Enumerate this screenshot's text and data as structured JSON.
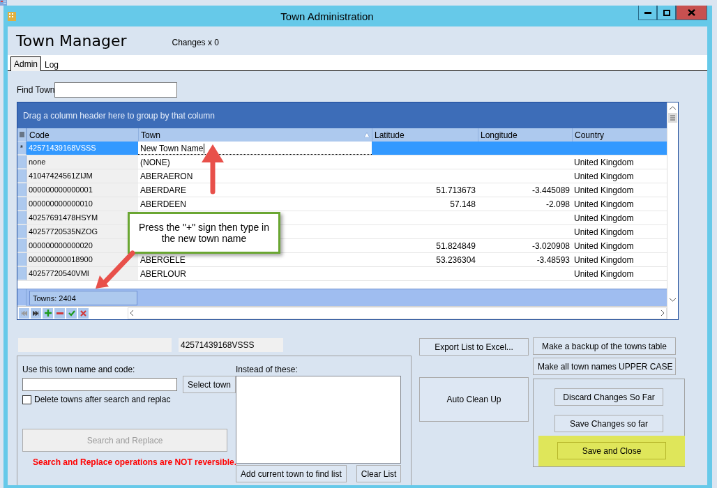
{
  "window": {
    "title": "Town Administration"
  },
  "header": {
    "title": "Town Manager",
    "changes": "Changes x 0"
  },
  "tabs": [
    {
      "label": "Admin",
      "selected": true
    },
    {
      "label": "Log",
      "selected": false
    }
  ],
  "find": {
    "label": "Find Town"
  },
  "grid": {
    "group_hint": "Drag a column header here to group by that column",
    "columns": [
      {
        "label": "Code",
        "sorted": false
      },
      {
        "label": "Town",
        "sorted": true
      },
      {
        "label": "Latitude",
        "sorted": false
      },
      {
        "label": "Longitude",
        "sorted": false
      },
      {
        "label": "Country",
        "sorted": false
      }
    ],
    "rows": [
      {
        "indicator": "*",
        "selected": true,
        "editing": true,
        "code": "42571439168VSSS",
        "town": "New Town Name"
      },
      {
        "selected": false,
        "editing": false,
        "code": "none",
        "town": "(NONE)",
        "country": "United Kingdom"
      },
      {
        "selected": false,
        "editing": false,
        "code": "41047424561ZIJM",
        "town": "ABERAERON",
        "country": "United Kingdom"
      },
      {
        "selected": false,
        "editing": false,
        "code": "000000000000001",
        "town": "ABERDARE",
        "latitude": "51.713673",
        "longitude": "-3.445089",
        "country": "United Kingdom"
      },
      {
        "selected": false,
        "editing": false,
        "code": "000000000000010",
        "town": "ABERDEEN",
        "latitude": "57.148",
        "longitude": "-2.098",
        "country": "United Kingdom"
      },
      {
        "selected": false,
        "editing": false,
        "code": "40257691478HSYM",
        "country": "United Kingdom"
      },
      {
        "selected": false,
        "editing": false,
        "code": "40257720535NZOG",
        "country": "United Kingdom"
      },
      {
        "selected": false,
        "editing": false,
        "code": "000000000000020",
        "latitude": "51.824849",
        "longitude": "-3.020908",
        "country": "United Kingdom"
      },
      {
        "selected": false,
        "editing": false,
        "code": "000000000018900",
        "town": "ABERGELE",
        "latitude": "53.236304",
        "longitude": "-3.48593",
        "country": "United Kingdom"
      },
      {
        "selected": false,
        "editing": false,
        "code": "40257720540VMI",
        "town": "ABERLOUR",
        "country": "United Kingdom"
      }
    ],
    "footer": "Towns: 2404"
  },
  "callout": "Press the \"+\" sign then type in the new town name",
  "selected_code": "42571439168VSSS",
  "replace": {
    "use_label": "Use this town name and code:",
    "select_button": "Select town",
    "delete_option": {
      "label": "Delete towns after search and replac",
      "checked": false
    },
    "search_button": {
      "label": "Search and Replace",
      "disabled": true
    },
    "warning": "Search and Replace operations are NOT reversible.",
    "instead_label": "Instead of these:",
    "add_button": "Add current town to find list",
    "clear_button": "Clear List"
  },
  "actions": {
    "export": "Export List to Excel...",
    "auto_clean": "Auto Clean Up",
    "backup": "Make a backup of the towns table",
    "upper_case": "Make all town names UPPER CASE",
    "discard": "Discard Changes So Far",
    "save_so_far": "Save Changes so far",
    "save_close": {
      "label": "Save and Close",
      "highlighted": true
    }
  }
}
